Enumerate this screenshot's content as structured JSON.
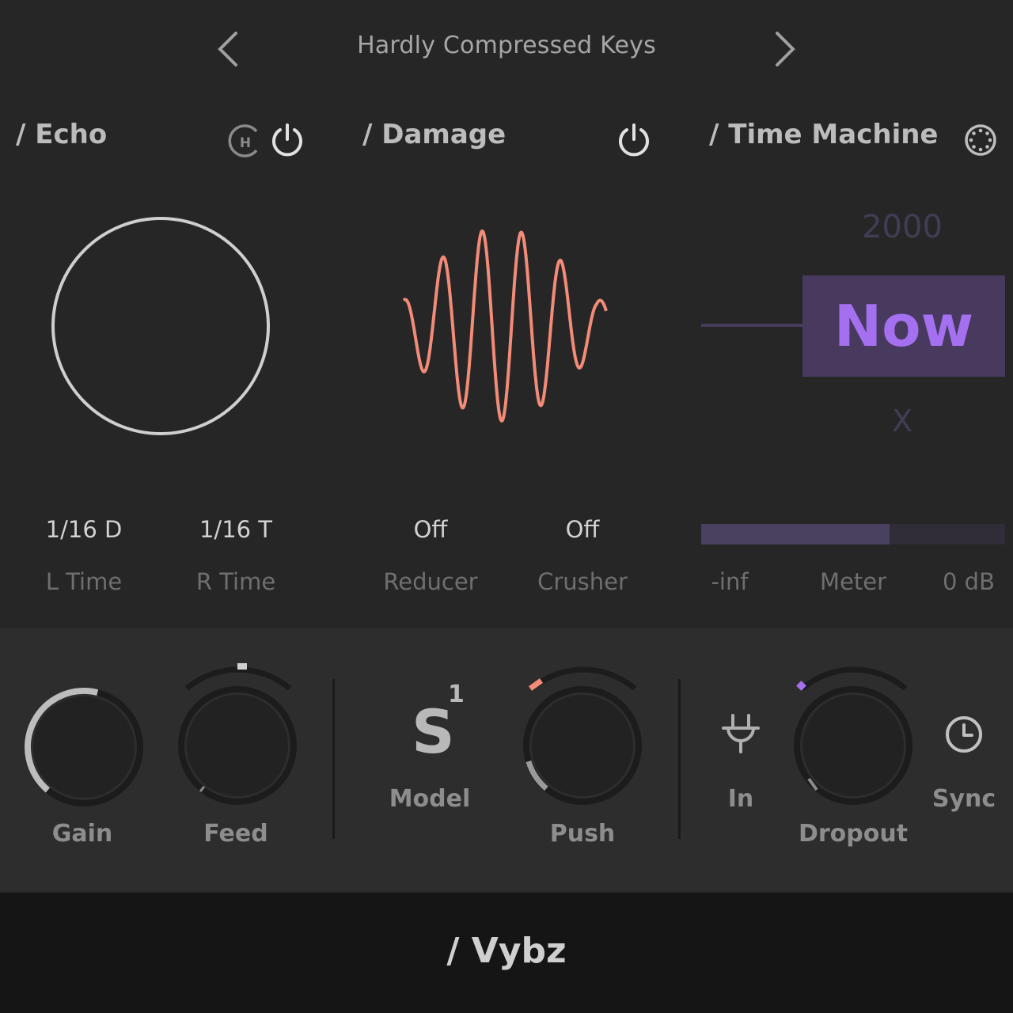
{
  "header": {
    "preset_name": "Hardly Compressed Keys",
    "prev_icon": "chevron-left-icon",
    "next_icon": "chevron-right-icon"
  },
  "echo": {
    "title": "/ Echo",
    "hold_icon": "h-badge-icon",
    "power_icon": "power-icon",
    "l_time_value": "1/16 D",
    "l_time_label": "L Time",
    "r_time_value": "1/16 T",
    "r_time_label": "R Time"
  },
  "damage": {
    "title": "/ Damage",
    "power_icon": "power-icon",
    "wave_color": "#f28b78",
    "reducer_value": "Off",
    "reducer_label": "Reducer",
    "crusher_value": "Off",
    "crusher_label": "Crusher"
  },
  "time_machine": {
    "title": "/ Time Machine",
    "settings_icon": "dial-icon",
    "year": "2000",
    "current": "Now",
    "x_label": "X",
    "accent": "#a570f0",
    "meter_level": 0.62,
    "meter_min": "-inf",
    "meter_label": "Meter",
    "meter_max": "0 dB"
  },
  "controls": {
    "gain": {
      "label": "Gain",
      "value": 0.55
    },
    "feed": {
      "label": "Feed",
      "value": 0.5
    },
    "model": {
      "label": "Model",
      "glyph": "S",
      "index": "1"
    },
    "push": {
      "label": "Push",
      "value": 0.12
    },
    "input": {
      "label": "In",
      "icon": "plug-icon"
    },
    "dropout": {
      "label": "Dropout",
      "value": 0.08
    },
    "sync": {
      "label": "Sync",
      "icon": "clock-icon"
    }
  },
  "footer": {
    "brand": "/ Vybz"
  }
}
